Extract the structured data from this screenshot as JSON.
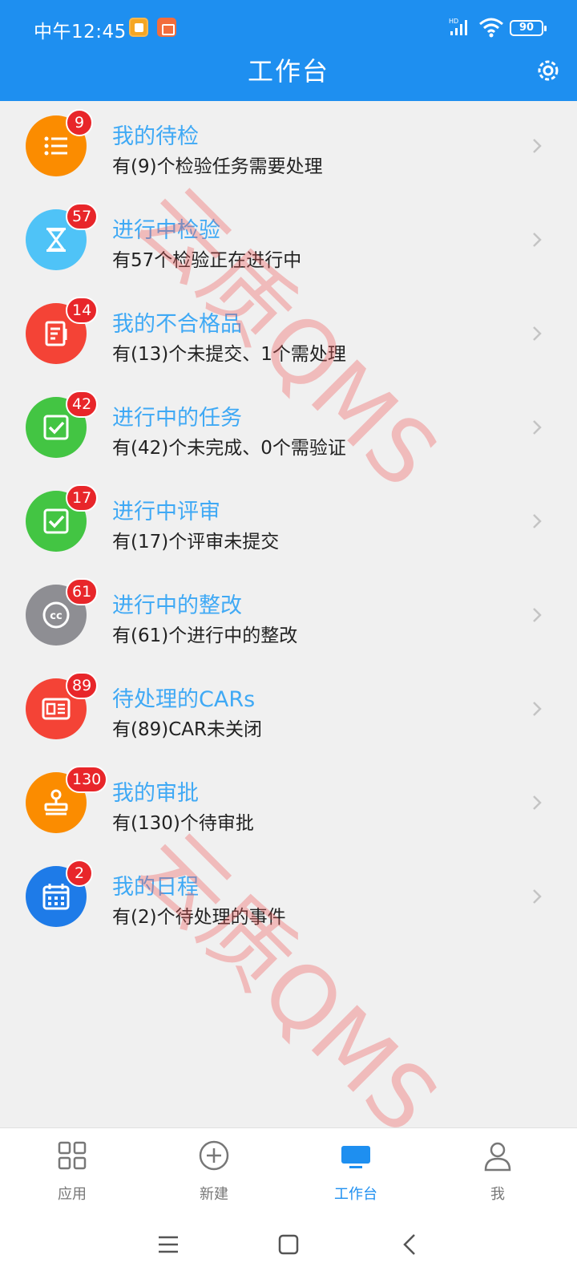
{
  "status_bar": {
    "time": "中午12:45",
    "battery": "90",
    "network": "HD"
  },
  "header": {
    "title": "工作台"
  },
  "items": [
    {
      "title": "我的待检",
      "subtitle": "有(9)个检验任务需要处理",
      "badge": "9",
      "color": "#fb8c00",
      "icon": "list-icon"
    },
    {
      "title": "进行中检验",
      "subtitle": "有57个检验正在进行中",
      "badge": "57",
      "color": "#4fc3f7",
      "icon": "hourglass-icon"
    },
    {
      "title": "我的不合格品",
      "subtitle": "有(13)个未提交、1个需处理",
      "badge": "14",
      "color": "#f44336",
      "icon": "document-icon"
    },
    {
      "title": "进行中的任务",
      "subtitle": "有(42)个未完成、0个需验证",
      "badge": "42",
      "color": "#43c543",
      "icon": "checkbox-icon"
    },
    {
      "title": "进行中评审",
      "subtitle": "有(17)个评审未提交",
      "badge": "17",
      "color": "#43c543",
      "icon": "checkbox-icon"
    },
    {
      "title": "进行中的整改",
      "subtitle": "有(61)个进行中的整改",
      "badge": "61",
      "color": "#8e8e93",
      "icon": "cc-icon"
    },
    {
      "title": "待处理的CARs",
      "subtitle": "有(89)CAR未关闭",
      "badge": "89",
      "color": "#f44336",
      "icon": "id-card-icon"
    },
    {
      "title": "我的审批",
      "subtitle": "有(130)个待审批",
      "badge": "130",
      "color": "#fb8c00",
      "icon": "stamp-icon"
    },
    {
      "title": "我的日程",
      "subtitle": "有(2)个待处理的事件",
      "badge": "2",
      "color": "#1e7be8",
      "icon": "calendar-icon"
    }
  ],
  "watermark": "云质QMS",
  "tabs": [
    {
      "label": "应用",
      "icon": "grid-icon",
      "active": false
    },
    {
      "label": "新建",
      "icon": "plus-circle-icon",
      "active": false
    },
    {
      "label": "工作台",
      "icon": "monitor-icon",
      "active": true
    },
    {
      "label": "我",
      "icon": "user-icon",
      "active": false
    }
  ],
  "nav_buttons": [
    "menu-icon",
    "home-icon",
    "back-icon"
  ],
  "accent_color": "#1e8ff0"
}
